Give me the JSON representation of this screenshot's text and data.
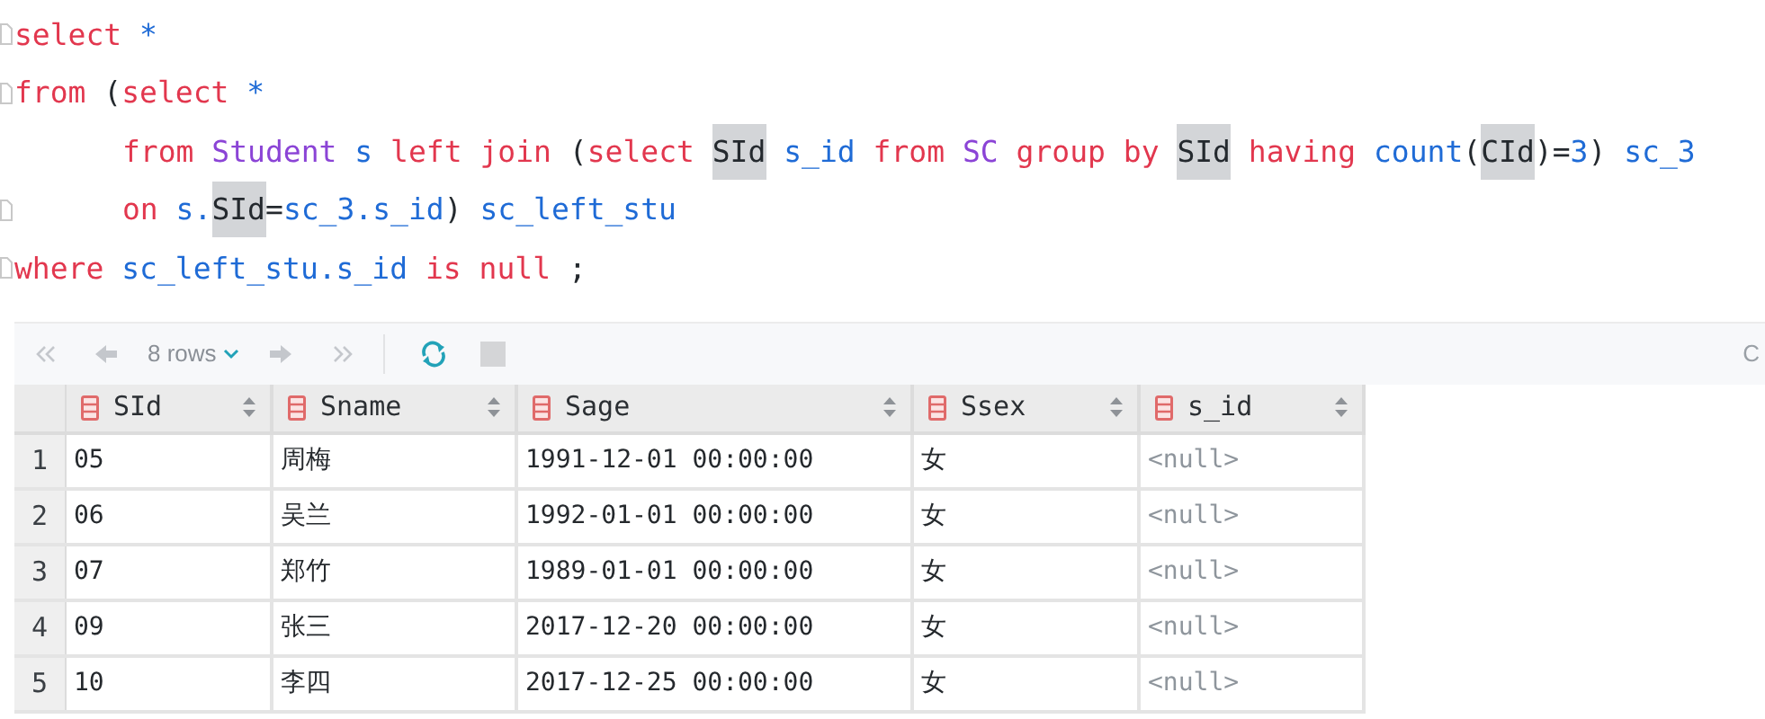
{
  "editor": {
    "lines": [
      {
        "indented": false,
        "fold": true,
        "tokens": [
          {
            "text": "select",
            "kind": "keyword"
          },
          {
            "text": " *",
            "kind": "ident"
          }
        ]
      },
      {
        "indented": false,
        "fold": true,
        "tokens": [
          {
            "text": "from",
            "kind": "keyword"
          },
          {
            "text": " (",
            "kind": "plain"
          },
          {
            "text": "select",
            "kind": "keyword"
          },
          {
            "text": " *",
            "kind": "ident"
          }
        ]
      },
      {
        "indented": true,
        "fold": false,
        "tokens": [
          {
            "text": "from",
            "kind": "keyword"
          },
          {
            "text": " Student",
            "kind": "table"
          },
          {
            "text": " s",
            "kind": "ident"
          },
          {
            "text": " left join",
            "kind": "keyword"
          },
          {
            "text": " (",
            "kind": "plain"
          },
          {
            "text": "select ",
            "kind": "keyword"
          },
          {
            "text": "SId",
            "kind": "plain",
            "highlighted": true
          },
          {
            "text": " s_id",
            "kind": "ident"
          },
          {
            "text": " from",
            "kind": "keyword"
          },
          {
            "text": " SC",
            "kind": "table"
          },
          {
            "text": " group by ",
            "kind": "keyword"
          },
          {
            "text": "SId",
            "kind": "plain",
            "highlighted": true
          },
          {
            "text": " having",
            "kind": "keyword"
          },
          {
            "text": " count",
            "kind": "ident"
          },
          {
            "text": "(",
            "kind": "plain"
          },
          {
            "text": "CId",
            "kind": "plain",
            "highlighted": true
          },
          {
            "text": ")=",
            "kind": "plain"
          },
          {
            "text": "3",
            "kind": "ident"
          },
          {
            "text": ")",
            "kind": "plain"
          },
          {
            "text": " sc_3",
            "kind": "ident"
          }
        ]
      },
      {
        "indented": true,
        "fold": true,
        "tokens": [
          {
            "text": "on",
            "kind": "keyword"
          },
          {
            "text": " s.",
            "kind": "ident"
          },
          {
            "text": "SId",
            "kind": "plain",
            "highlighted": true
          },
          {
            "text": "=",
            "kind": "plain"
          },
          {
            "text": "sc_3.s_id",
            "kind": "ident"
          },
          {
            "text": ")",
            "kind": "plain"
          },
          {
            "text": " sc_left_stu",
            "kind": "ident"
          }
        ]
      },
      {
        "indented": false,
        "fold": true,
        "tokens": [
          {
            "text": "where",
            "kind": "keyword"
          },
          {
            "text": " sc_left_stu.s_id",
            "kind": "ident"
          },
          {
            "text": " is null",
            "kind": "keyword"
          },
          {
            "text": " ;",
            "kind": "plain"
          }
        ]
      }
    ]
  },
  "toolbar": {
    "row_count": "8 rows",
    "right_text": "C"
  },
  "table": {
    "columns": [
      "SId",
      "Sname",
      "Sage",
      "Ssex",
      "s_id"
    ],
    "rows": [
      {
        "number": "1",
        "cells": [
          {
            "text": "05",
            "kind": "value"
          },
          {
            "text": "周梅",
            "kind": "value"
          },
          {
            "text": "1991-12-01 00:00:00",
            "kind": "value"
          },
          {
            "text": "女",
            "kind": "value"
          },
          {
            "text": "<null>",
            "kind": "null"
          }
        ]
      },
      {
        "number": "2",
        "cells": [
          {
            "text": "06",
            "kind": "value"
          },
          {
            "text": "吴兰",
            "kind": "value"
          },
          {
            "text": "1992-01-01 00:00:00",
            "kind": "value"
          },
          {
            "text": "女",
            "kind": "value"
          },
          {
            "text": "<null>",
            "kind": "null"
          }
        ]
      },
      {
        "number": "3",
        "cells": [
          {
            "text": "07",
            "kind": "value"
          },
          {
            "text": "郑竹",
            "kind": "value"
          },
          {
            "text": "1989-01-01 00:00:00",
            "kind": "value"
          },
          {
            "text": "女",
            "kind": "value"
          },
          {
            "text": "<null>",
            "kind": "null"
          }
        ]
      },
      {
        "number": "4",
        "cells": [
          {
            "text": "09",
            "kind": "value"
          },
          {
            "text": "张三",
            "kind": "value"
          },
          {
            "text": "2017-12-20 00:00:00",
            "kind": "value"
          },
          {
            "text": "女",
            "kind": "value"
          },
          {
            "text": "<null>",
            "kind": "null"
          }
        ]
      },
      {
        "number": "5",
        "cells": [
          {
            "text": "10",
            "kind": "value"
          },
          {
            "text": "李四",
            "kind": "value"
          },
          {
            "text": "2017-12-25 00:00:00",
            "kind": "value"
          },
          {
            "text": "女",
            "kind": "value"
          },
          {
            "text": "<null>",
            "kind": "null"
          }
        ]
      }
    ]
  }
}
